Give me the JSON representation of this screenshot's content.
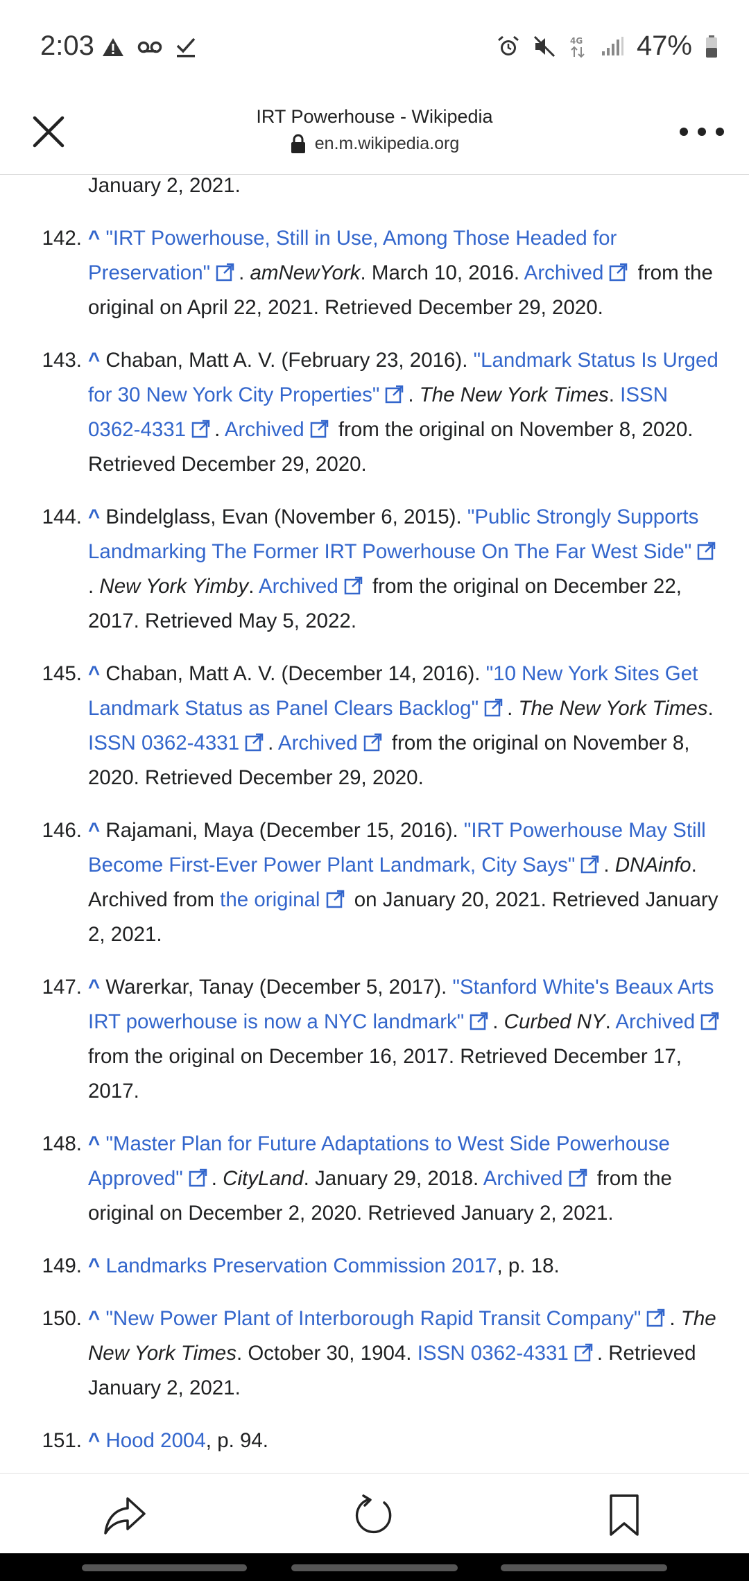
{
  "status": {
    "time": "2:03",
    "battery": "47%",
    "left_icons": [
      "warning-icon",
      "voicemail-icon",
      "check-icon"
    ],
    "right_icons": [
      "alarm-icon",
      "mute-icon",
      "4g-data-icon",
      "signal-icon",
      "battery-icon"
    ]
  },
  "browser": {
    "title": "IRT Powerhouse - Wikipedia",
    "url": "en.m.wikipedia.org"
  },
  "references": [
    {
      "num": "",
      "segments": [
        {
          "t": "January 2, 2021."
        }
      ]
    },
    {
      "num": "142.",
      "segments": [
        {
          "t": "^",
          "c": "caret"
        },
        {
          "t": " "
        },
        {
          "t": "\"IRT Powerhouse, Still in Use, Among Those Headed for Preservation\"",
          "c": "link",
          "ext": true
        },
        {
          "t": ". "
        },
        {
          "t": "amNewYork",
          "c": "i"
        },
        {
          "t": ". March 10, 2016. "
        },
        {
          "t": "Archived",
          "c": "link",
          "ext": true
        },
        {
          "t": " from the original on April 22, 2021. Retrieved December 29, 2020."
        }
      ]
    },
    {
      "num": "143.",
      "segments": [
        {
          "t": "^",
          "c": "caret"
        },
        {
          "t": " Chaban, Matt A. V. (February 23, 2016). "
        },
        {
          "t": "\"Landmark Status Is Urged for 30 New York City Properties\"",
          "c": "link",
          "ext": true
        },
        {
          "t": ". "
        },
        {
          "t": "The New York Times",
          "c": "i"
        },
        {
          "t": ". "
        },
        {
          "t": "ISSN 0362-4331",
          "c": "link",
          "ext": true
        },
        {
          "t": ". "
        },
        {
          "t": "Archived",
          "c": "link",
          "ext": true
        },
        {
          "t": " from the original on November 8, 2020. Retrieved December 29, 2020."
        }
      ]
    },
    {
      "num": "144.",
      "segments": [
        {
          "t": "^",
          "c": "caret"
        },
        {
          "t": " Bindelglass, Evan (November 6, 2015). "
        },
        {
          "t": "\"Public Strongly Supports Landmarking The Former IRT Powerhouse On The Far West Side\"",
          "c": "link",
          "ext": true
        },
        {
          "t": ". "
        },
        {
          "t": "New York Yimby",
          "c": "i"
        },
        {
          "t": ". "
        },
        {
          "t": "Archived",
          "c": "link",
          "ext": true
        },
        {
          "t": " from the original on December 22, 2017. Retrieved May 5, 2022."
        }
      ]
    },
    {
      "num": "145.",
      "segments": [
        {
          "t": "^",
          "c": "caret"
        },
        {
          "t": " Chaban, Matt A. V. (December 14, 2016). "
        },
        {
          "t": "\"10 New York Sites Get Landmark Status as Panel Clears Backlog\"",
          "c": "link",
          "ext": true
        },
        {
          "t": ". "
        },
        {
          "t": "The New York Times",
          "c": "i"
        },
        {
          "t": ". "
        },
        {
          "t": "ISSN 0362-4331",
          "c": "link",
          "ext": true
        },
        {
          "t": ". "
        },
        {
          "t": "Archived",
          "c": "link",
          "ext": true
        },
        {
          "t": " from the original on November 8, 2020. Retrieved December 29, 2020."
        }
      ]
    },
    {
      "num": "146.",
      "segments": [
        {
          "t": "^",
          "c": "caret"
        },
        {
          "t": " Rajamani, Maya (December 15, 2016). "
        },
        {
          "t": "\"IRT Powerhouse May Still Become First-Ever Power Plant Landmark, City Says\"",
          "c": "link",
          "ext": true
        },
        {
          "t": ". "
        },
        {
          "t": "DNAinfo",
          "c": "i"
        },
        {
          "t": ". Archived from "
        },
        {
          "t": "the original",
          "c": "link",
          "ext": true
        },
        {
          "t": " on January 20, 2021. Retrieved January 2, 2021."
        }
      ]
    },
    {
      "num": "147.",
      "segments": [
        {
          "t": "^",
          "c": "caret"
        },
        {
          "t": " Warerkar, Tanay (December 5, 2017). "
        },
        {
          "t": "\"Stanford White's Beaux Arts IRT powerhouse is now a NYC landmark\"",
          "c": "link",
          "ext": true
        },
        {
          "t": ". "
        },
        {
          "t": "Curbed NY",
          "c": "i"
        },
        {
          "t": ". "
        },
        {
          "t": "Archived",
          "c": "link",
          "ext": true
        },
        {
          "t": " from the original on December 16, 2017. Retrieved December 17, 2017."
        }
      ]
    },
    {
      "num": "148.",
      "segments": [
        {
          "t": "^",
          "c": "caret"
        },
        {
          "t": " "
        },
        {
          "t": "\"Master Plan for Future Adaptations to West Side Powerhouse Approved\"",
          "c": "link",
          "ext": true
        },
        {
          "t": ". "
        },
        {
          "t": "CityLand",
          "c": "i"
        },
        {
          "t": ". January 29, 2018. "
        },
        {
          "t": "Archived",
          "c": "link",
          "ext": true
        },
        {
          "t": " from the original on December 2, 2020. Retrieved January 2, 2021."
        }
      ]
    },
    {
      "num": "149.",
      "segments": [
        {
          "t": "^",
          "c": "caret"
        },
        {
          "t": " "
        },
        {
          "t": "Landmarks Preservation Commission 2017",
          "c": "link"
        },
        {
          "t": ", p. 18."
        }
      ]
    },
    {
      "num": "150.",
      "segments": [
        {
          "t": "^",
          "c": "caret"
        },
        {
          "t": " "
        },
        {
          "t": "\"New Power Plant of Interborough Rapid Transit Company\"",
          "c": "link",
          "ext": true
        },
        {
          "t": ". "
        },
        {
          "t": "The New York Times",
          "c": "i"
        },
        {
          "t": ". October 30, 1904. "
        },
        {
          "t": "ISSN 0362-4331",
          "c": "link",
          "ext": true
        },
        {
          "t": ". Retrieved January 2, 2021."
        }
      ]
    },
    {
      "num": "151.",
      "segments": [
        {
          "t": "^",
          "c": "caret"
        },
        {
          "t": " "
        },
        {
          "t": "Hood 2004",
          "c": "link"
        },
        {
          "t": ", p. 94."
        }
      ]
    }
  ],
  "bottom_nav": {
    "icons": [
      "share-icon",
      "reload-icon",
      "bookmark-icon"
    ]
  }
}
